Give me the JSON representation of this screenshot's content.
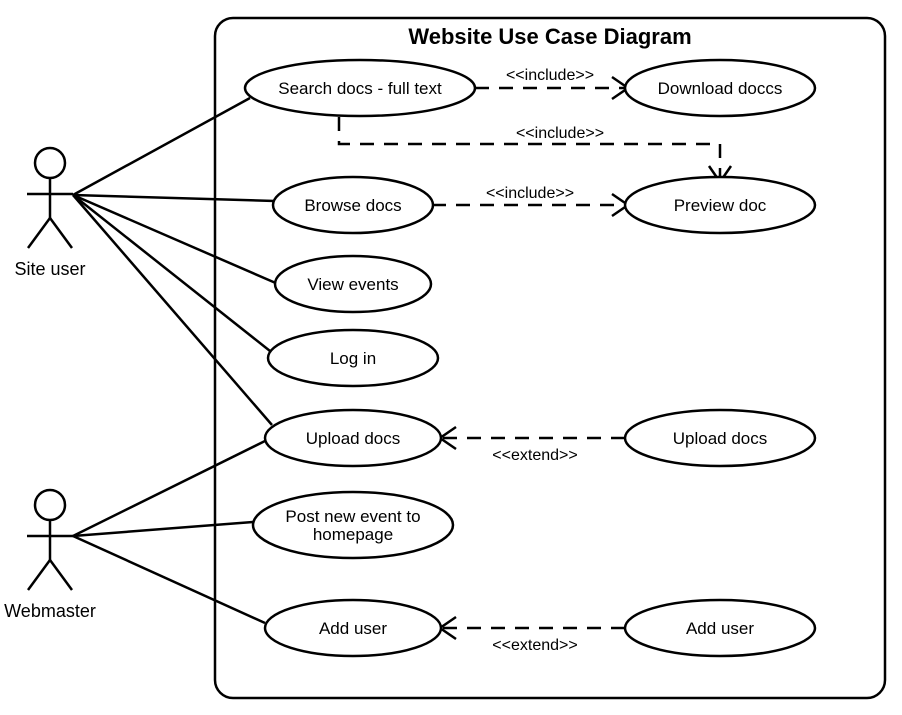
{
  "title": "Website Use Case Diagram",
  "actors": {
    "siteUser": "Site user",
    "webmaster": "Webmaster"
  },
  "usecases": {
    "search": "Search docs - full text",
    "download": "Download doccs",
    "browse": "Browse docs",
    "preview": "Preview doc",
    "viewEvents": "View events",
    "login": "Log in",
    "uploadLeft": "Upload docs",
    "uploadRight": "Upload docs",
    "postEvent1": "Post new event to",
    "postEvent2": "homepage",
    "addUserLeft": "Add user",
    "addUserRight": "Add user"
  },
  "stereotypes": {
    "include1": "<<include>>",
    "include2": "<<include>>",
    "include3": "<<include>>",
    "extend1": "<<extend>>",
    "extend2": "<<extend>>"
  }
}
